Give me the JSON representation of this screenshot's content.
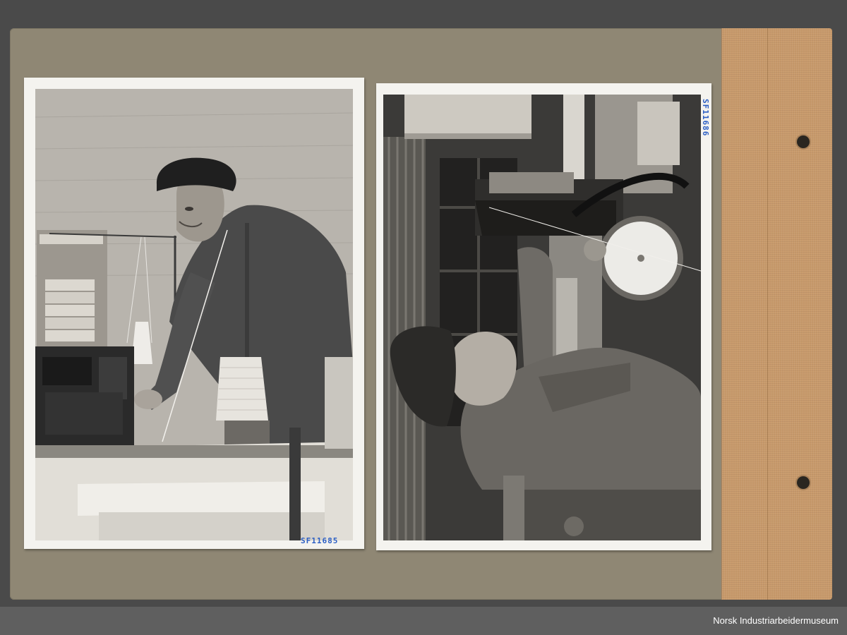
{
  "album": {
    "background_color": "#4a4a4a",
    "page_color": "#8f8774",
    "spine_color": "#c89a6b"
  },
  "photos": [
    {
      "inventory_number": "SF11685",
      "subject": "worker at thread winding machine"
    },
    {
      "inventory_number": "SF11686",
      "subject": "worker looking up at machine"
    }
  ],
  "footer": {
    "credit": "Norsk Industriarbeidermuseum"
  }
}
